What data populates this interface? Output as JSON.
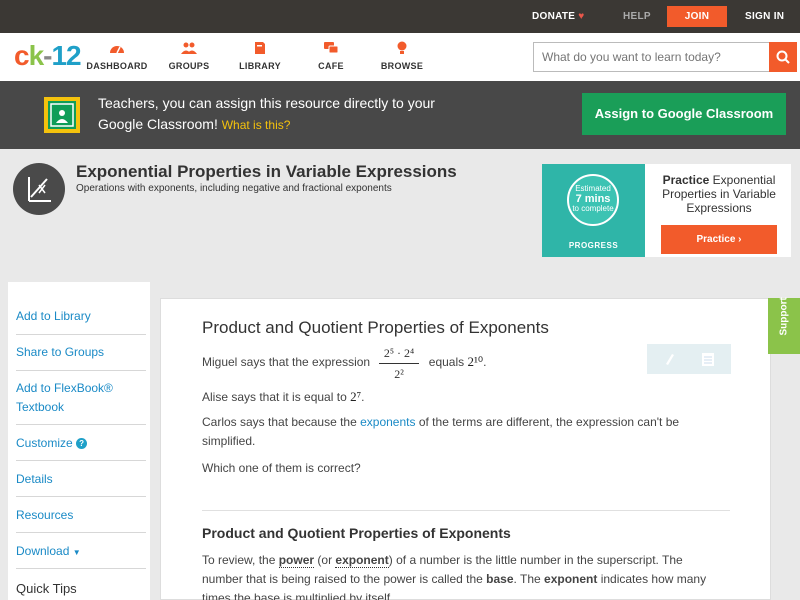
{
  "topbar": {
    "donate": "DONATE",
    "help": "HELP",
    "join": "JOIN",
    "signin": "SIGN IN"
  },
  "logo": {
    "c": "c",
    "k": "k",
    "dash": "-",
    "num": "12"
  },
  "nav": [
    {
      "label": "DASHBOARD",
      "icon": "dashboard-icon"
    },
    {
      "label": "GROUPS",
      "icon": "groups-icon"
    },
    {
      "label": "LIBRARY",
      "icon": "library-icon"
    },
    {
      "label": "CAFE",
      "icon": "cafe-icon"
    },
    {
      "label": "BROWSE",
      "icon": "browse-icon"
    }
  ],
  "search": {
    "placeholder": "What do you want to learn today?"
  },
  "banner": {
    "text": "Teachers, you can assign this resource directly to your Google Classroom!",
    "what": "What is this?",
    "button": "Assign to Google Classroom"
  },
  "concept": {
    "title": "Exponential Properties in Variable Expressions",
    "subtitle": "Operations with exponents, including negative and fractional exponents"
  },
  "practice": {
    "estimated": "Estimated",
    "mins": "7 mins",
    "to_complete": "to complete",
    "progress": "PROGRESS",
    "bold": "Practice",
    "rest": " Exponential Properties in Variable Expressions",
    "button": "Practice"
  },
  "sidebar": {
    "items": [
      "Add to Library",
      "Share to Groups",
      "Add to FlexBook® Textbook",
      "Customize",
      "Details",
      "Resources",
      "Download"
    ],
    "tips": "Quick Tips"
  },
  "main": {
    "title": "Product and Quotient Properties of Exponents",
    "p1_a": "Miguel says that the expression",
    "p1_b": "equals",
    "frac_num": "2⁵ · 2⁴",
    "frac_den": "2²",
    "p1_val": "2¹⁰",
    "p2_a": "Alise says that it is equal to",
    "p2_val": "2⁷",
    "p3_a": "Carlos says that because the",
    "p3_link": "exponents",
    "p3_b": "of the terms are different, the expression can't be simplified.",
    "p4": "Which one of them is correct?",
    "h2": "Product and Quotient Properties of Exponents",
    "p5_a": "To review, the",
    "p5_power": "power",
    "p5_or": "(or",
    "p5_exp": "exponent",
    "p5_b": ") of a number is the little number in the superscript. The number that is being raised to the power is called the",
    "p5_base": "base",
    "p5_c": ". The",
    "p5_exp2": "exponent",
    "p5_d": "indicates how many times the base is multiplied by itself."
  },
  "support": "Support",
  "colors": {
    "accent": "#f25b2b",
    "green": "#1a9e58",
    "link": "#1a8ac6"
  }
}
